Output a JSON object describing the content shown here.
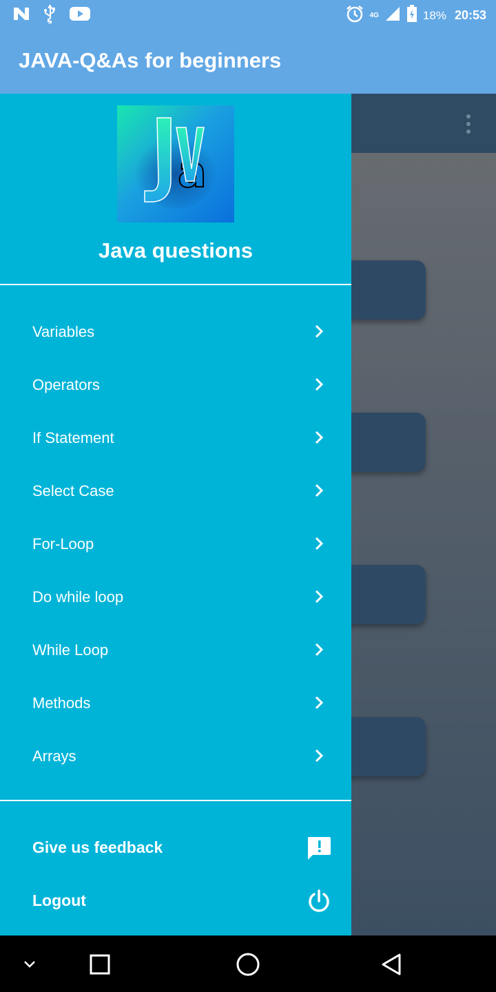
{
  "status_bar": {
    "left_icons": [
      "n-icon",
      "usb-icon",
      "youtube-icon"
    ],
    "alarm_icon": "alarm-icon",
    "network": "4G",
    "battery": "18%",
    "time": "20:53"
  },
  "app_bar": {
    "title": "JAVA-Q&As for beginners"
  },
  "drawer": {
    "logo_text": "Jv",
    "header_title": "Java questions",
    "menu": [
      {
        "label": "Variables"
      },
      {
        "label": "Operators"
      },
      {
        "label": "If Statement"
      },
      {
        "label": "Select Case"
      },
      {
        "label": "For-Loop"
      },
      {
        "label": "Do while loop"
      },
      {
        "label": "While Loop"
      },
      {
        "label": "Methods"
      },
      {
        "label": "Arrays"
      }
    ],
    "footer": {
      "feedback_label": "Give us feedback",
      "logout_label": "Logout"
    }
  },
  "colors": {
    "app_bar": "#62a8e5",
    "drawer": "#00b4d8",
    "text": "#ffffff"
  }
}
